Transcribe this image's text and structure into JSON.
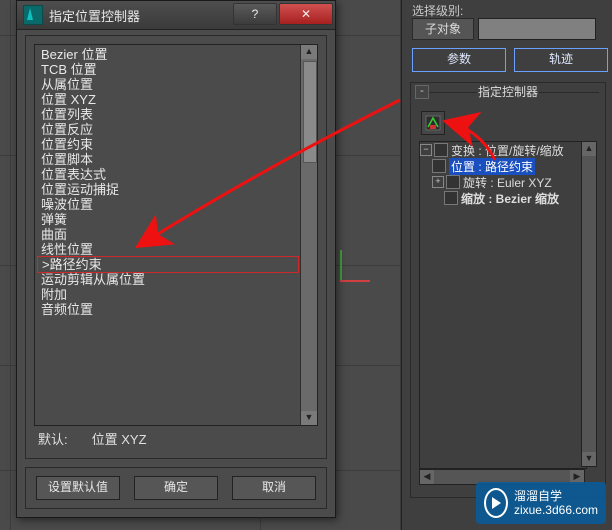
{
  "right_panel": {
    "select_level_label": "选择级别:",
    "sub_object_btn": "子对象",
    "tabs": {
      "params": "参数",
      "tracks": "轨迹"
    },
    "rollout_title": "指定控制器",
    "tree": {
      "root": {
        "toggle": "−",
        "label": "变换 : 位置/旋转/缩放"
      },
      "pos": {
        "label_a": "位置 :",
        "label_b": "路径约束"
      },
      "rot": {
        "toggle": "+",
        "label": "旋转 : Euler XYZ"
      },
      "scale": {
        "label": "缩放 : Bezier 缩放"
      }
    }
  },
  "dialog": {
    "title": "指定位置控制器",
    "items": [
      "Bezier 位置",
      "TCB 位置",
      "从属位置",
      "位置 XYZ",
      "位置列表",
      "位置反应",
      "位置约束",
      "位置脚本",
      "位置表达式",
      "位置运动捕捉",
      "噪波位置",
      "弹簧",
      "曲面",
      "线性位置",
      ">路径约束",
      "运动剪辑从属位置",
      "附加",
      "音频位置"
    ],
    "selected_index": 14,
    "default_label": "默认:",
    "default_value": "位置 XYZ",
    "set_default_btn": "设置默认值",
    "ok_btn": "确定",
    "cancel_btn": "取消"
  },
  "watermark": {
    "name": "溜溜自学",
    "url": "zixue.3d66.com"
  }
}
